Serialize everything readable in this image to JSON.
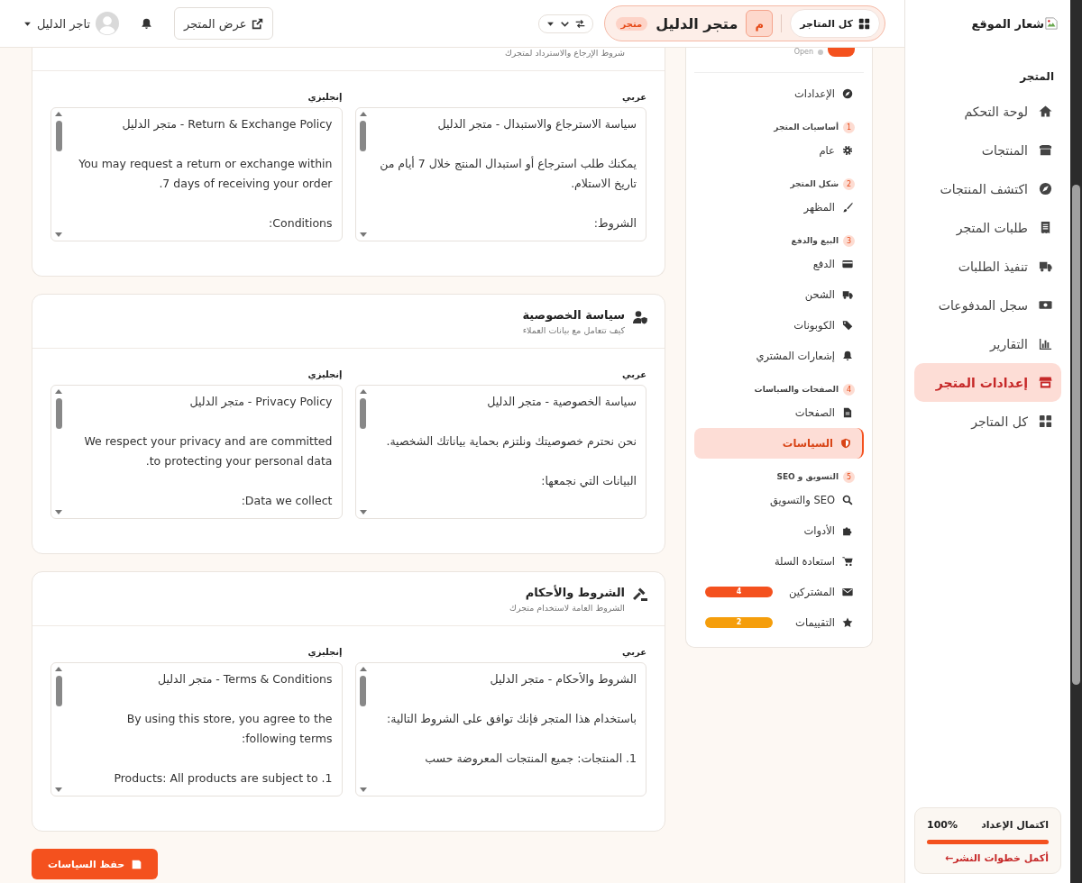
{
  "header": {
    "logo_alt": "شعار الموقع",
    "all_stores": "كل المتاجر",
    "store_initial": "م",
    "store_name": "متجر الدليل",
    "store_badge": "متجر",
    "view_store": "عرض المتجر",
    "user_name": "تاجر الدليل"
  },
  "sidebar": {
    "section": "المتجر",
    "items": [
      {
        "label": "لوحة التحكم",
        "selected": false
      },
      {
        "label": "المنتجات",
        "selected": false
      },
      {
        "label": "اكتشف المنتجات",
        "selected": false
      },
      {
        "label": "طلبات المتجر",
        "selected": false
      },
      {
        "label": "تنفيذ الطلبات",
        "selected": false
      },
      {
        "label": "سجل المدفوعات",
        "selected": false
      },
      {
        "label": "التقارير",
        "selected": false
      },
      {
        "label": "إعدادات المتجر",
        "selected": true
      },
      {
        "label": "كل المتاجر",
        "selected": false
      }
    ],
    "progress": {
      "title": "اكتمال الإعداد",
      "percent": "100%",
      "level": 1,
      "link": "أكمل خطوات النشر←"
    }
  },
  "settings_nav": {
    "status": "Open",
    "root": {
      "label": "الإعدادات",
      "selected": false
    },
    "groups": [
      {
        "number": "1",
        "title": "أساسيات المتجر",
        "children": [
          {
            "label": "عام",
            "selected": false
          }
        ]
      },
      {
        "number": "2",
        "title": "شكل المتجر",
        "children": [
          {
            "label": "المظهر",
            "selected": false
          }
        ]
      },
      {
        "number": "3",
        "title": "البيع والدفع",
        "children": [
          {
            "label": "الدفع",
            "selected": false
          },
          {
            "label": "الشحن",
            "selected": false
          },
          {
            "label": "الكوبونات",
            "selected": false
          },
          {
            "label": "إشعارات المشتري",
            "selected": false
          }
        ]
      },
      {
        "number": "4",
        "title": "الصفحات والسياسات",
        "children": [
          {
            "label": "الصفحات",
            "selected": false
          },
          {
            "label": "السياسات",
            "selected": true
          }
        ]
      },
      {
        "number": "5",
        "title": "التسويق و SEO",
        "children": [
          {
            "label": "SEO والتسويق",
            "selected": false
          },
          {
            "label": "الأدوات",
            "selected": false
          },
          {
            "label": "استعادة السلة",
            "selected": false
          },
          {
            "label": "المشتركين",
            "selected": false,
            "badge": "4",
            "color": "#f4511e"
          },
          {
            "label": "التقييمات",
            "selected": false,
            "badge": "2",
            "color": "#f59e0b"
          }
        ]
      }
    ]
  },
  "policies": [
    {
      "subtitle": "شروط الإرجاع والاسترداد لمتجرك",
      "fields": [
        {
          "label": "عربي",
          "value": "سياسة الاسترجاع والاستبدال - متجر الدليل\n\nيمكنك طلب استرجاع أو استبدال المنتج خلال 7 أيام من تاريخ الاستلام.\n\nالشروط:"
        },
        {
          "label": "إنجليزي",
          "value": "Return & Exchange Policy - متجر الدليل\n\nYou may request a return or exchange within 7 days of receiving your order.\n\nConditions:"
        }
      ]
    },
    {
      "title": "سياسة الخصوصية",
      "subtitle": "كيف تتعامل مع بيانات العملاء",
      "fields": [
        {
          "label": "عربي",
          "value": "سياسة الخصوصية - متجر الدليل\n\nنحن نحترم خصوصيتك ونلتزم بحماية بياناتك الشخصية.\n\nالبيانات التي نجمعها:"
        },
        {
          "label": "إنجليزي",
          "value": "Privacy Policy - متجر الدليل\n\nWe respect your privacy and are committed to protecting your personal data.\n\nData we collect:"
        }
      ]
    },
    {
      "title": "الشروط والأحكام",
      "subtitle": "الشروط العامة لاستخدام متجرك",
      "fields": [
        {
          "label": "عربي",
          "value": "الشروط والأحكام - متجر الدليل\n\nباستخدام هذا المتجر فإنك توافق على الشروط التالية:\n\n1. المنتجات: جميع المنتجات المعروضة حسب"
        },
        {
          "label": "إنجليزي",
          "value": "Terms & Conditions - متجر الدليل\n\nBy using this store, you agree to the following terms:\n\n1. Products: All products are subject to"
        }
      ]
    }
  ],
  "save_button": "حفظ السياسات"
}
